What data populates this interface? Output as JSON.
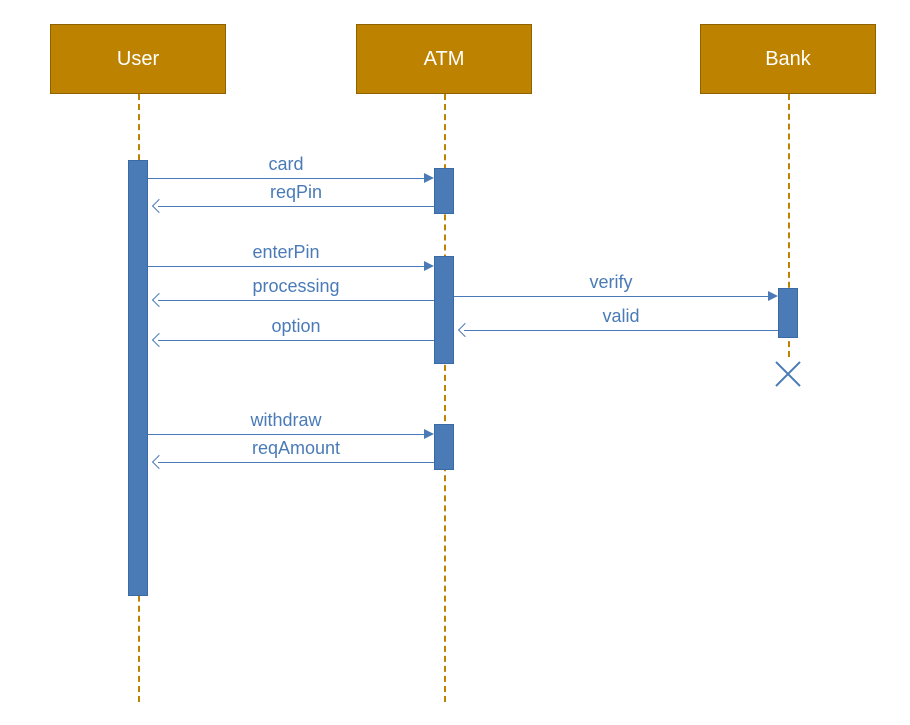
{
  "actors": {
    "user": "User",
    "atm": "ATM",
    "bank": "Bank"
  },
  "messages": {
    "card": "card",
    "reqPin": "reqPin",
    "enterPin": "enterPin",
    "processing": "processing",
    "verify": "verify",
    "valid": "valid",
    "option": "option",
    "withdraw": "withdraw",
    "reqAmount": "reqAmount"
  },
  "colors": {
    "actor_bg": "#bd8200",
    "actor_fg": "#ffffff",
    "lifeline": "#bd8200",
    "activation": "#4a7bb7",
    "message": "#4a7bb7"
  }
}
